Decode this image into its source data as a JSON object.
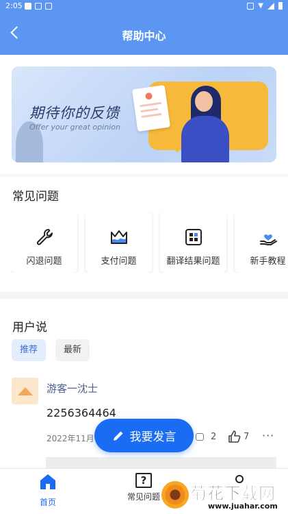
{
  "status_bar": {
    "time": "2:05"
  },
  "header": {
    "title": "帮助中心"
  },
  "banner": {
    "title": "期待你的反馈",
    "subtitle": "Offer your great opinion"
  },
  "faq": {
    "title": "常见问题",
    "items": [
      {
        "label": "闪退问题",
        "icon": "wrench-icon"
      },
      {
        "label": "支付问题",
        "icon": "crown-icon"
      },
      {
        "label": "翻译结果问题",
        "icon": "grid-icon"
      },
      {
        "label": "新手教程",
        "icon": "heart-hand-icon"
      }
    ]
  },
  "user_says": {
    "title": "用户说",
    "filters": [
      {
        "label": "推荐",
        "active": true
      },
      {
        "label": "最新",
        "active": false
      }
    ],
    "post": {
      "username": "游客一沈士",
      "content": "2256364464",
      "date": "2022年11月",
      "comments": "2",
      "likes": "7",
      "more": "···"
    }
  },
  "fab": {
    "label": "我要发言"
  },
  "bottom_nav": [
    {
      "label": "首页",
      "active": true
    },
    {
      "label": "常见问题",
      "active": false
    },
    {
      "label": "",
      "active": false
    }
  ],
  "watermark": {
    "title": "菊花下载网",
    "url": "www.juahar.com"
  },
  "colors": {
    "primary": "#5b97f2",
    "accent": "#1a6cf2",
    "active_chip_bg": "#e4edfc"
  }
}
